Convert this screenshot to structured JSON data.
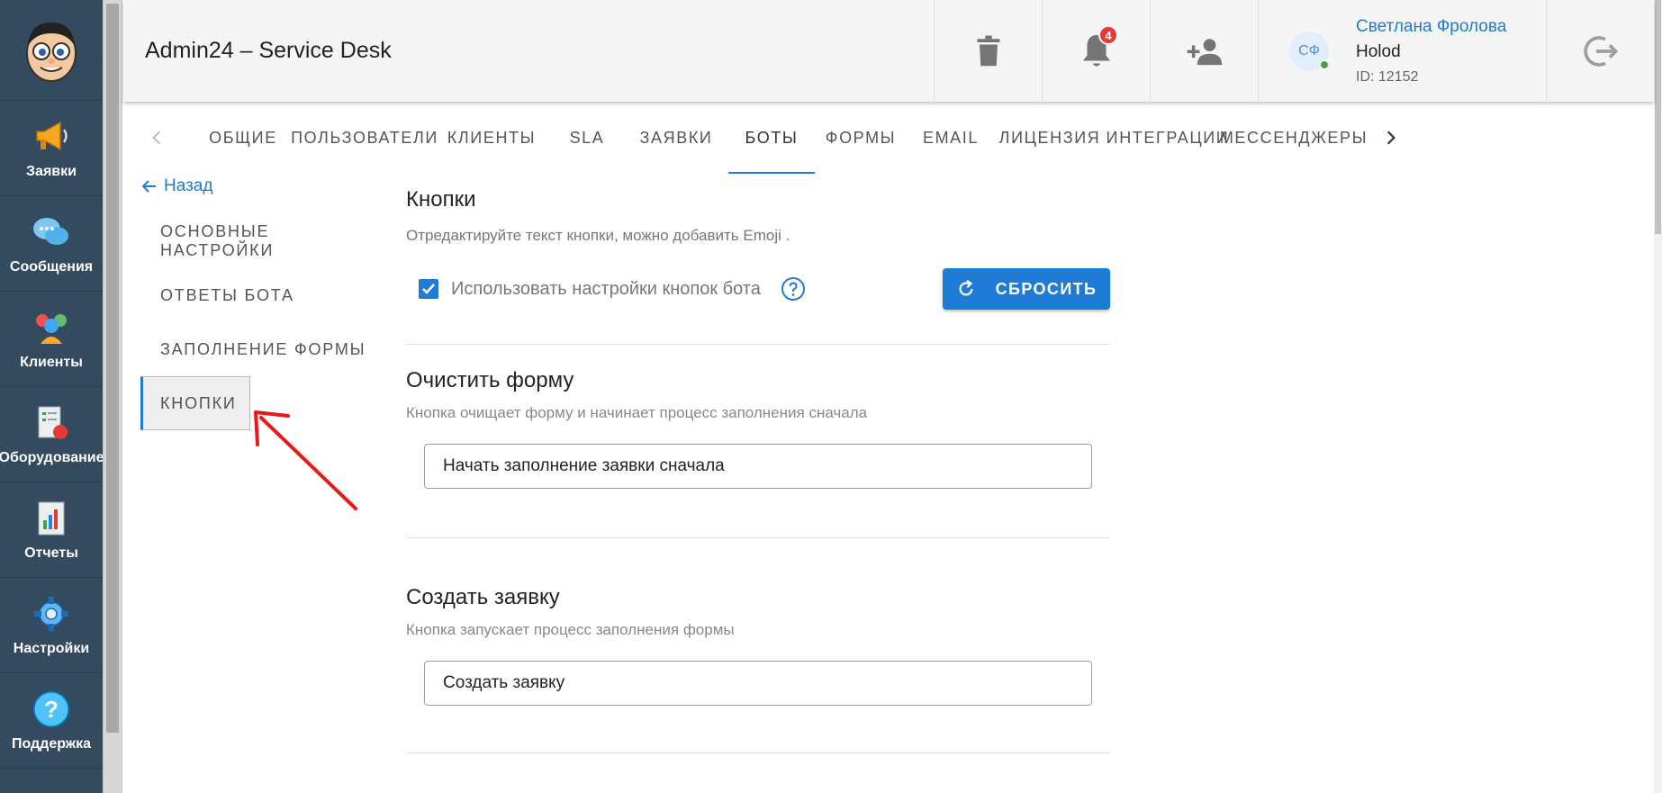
{
  "nav": [
    {
      "label": "Заявки",
      "icon": "megaphone-icon"
    },
    {
      "label": "Сообщения",
      "icon": "chat-bubbles-icon"
    },
    {
      "label": "Клиенты",
      "icon": "clients-icon"
    },
    {
      "label": "Оборудование",
      "icon": "equipment-icon"
    },
    {
      "label": "Отчеты",
      "icon": "report-icon"
    },
    {
      "label": "Настройки",
      "icon": "gear-icon"
    },
    {
      "label": "Поддержка",
      "icon": "help-icon"
    }
  ],
  "header": {
    "title": "Admin24 – Service Desk",
    "notifications_count": "4",
    "user": {
      "initials": "СФ",
      "name": "Светлана Фролова",
      "org": "Holod",
      "id": "ID: 12152"
    }
  },
  "tabs": [
    "ОБЩИЕ",
    "ПОЛЬЗОВАТЕЛИ",
    "КЛИЕНТЫ",
    "SLA",
    "ЗАЯВКИ",
    "БОТЫ",
    "ФОРМЫ",
    "EMAIL",
    "ЛИЦЕНЗИЯ",
    "ИНТЕГРАЦИИ",
    "МЕССЕНДЖЕРЫ"
  ],
  "active_tab": "БОТЫ",
  "side": {
    "back_label": "Назад",
    "items": [
      "ОСНОВНЫЕ НАСТРОЙКИ",
      "ОТВЕТЫ БОТА",
      "ЗАПОЛНЕНИЕ ФОРМЫ",
      "КНОПКИ"
    ],
    "active": "КНОПКИ"
  },
  "content": {
    "title": "Кнопки",
    "desc": "Отредактируйте текст кнопки, можно добавить Emoji .",
    "checkbox_label": "Использовать настройки кнопок бота",
    "checkbox_checked": true,
    "reset_label": "СБРОСИТЬ",
    "sections": [
      {
        "title": "Очистить форму",
        "desc": "Кнопка очищает форму и начинает процесс заполнения сначала",
        "value": "Начать заполнение заявки сначала"
      },
      {
        "title": "Создать заявку",
        "desc": "Кнопка запускает процесс заполнения формы",
        "value": "Создать заявку"
      }
    ]
  },
  "colors": {
    "accent": "#1e7bd6",
    "nav_bg": "#344a5f",
    "badge": "#e53935",
    "annotation": "#e8191a"
  }
}
